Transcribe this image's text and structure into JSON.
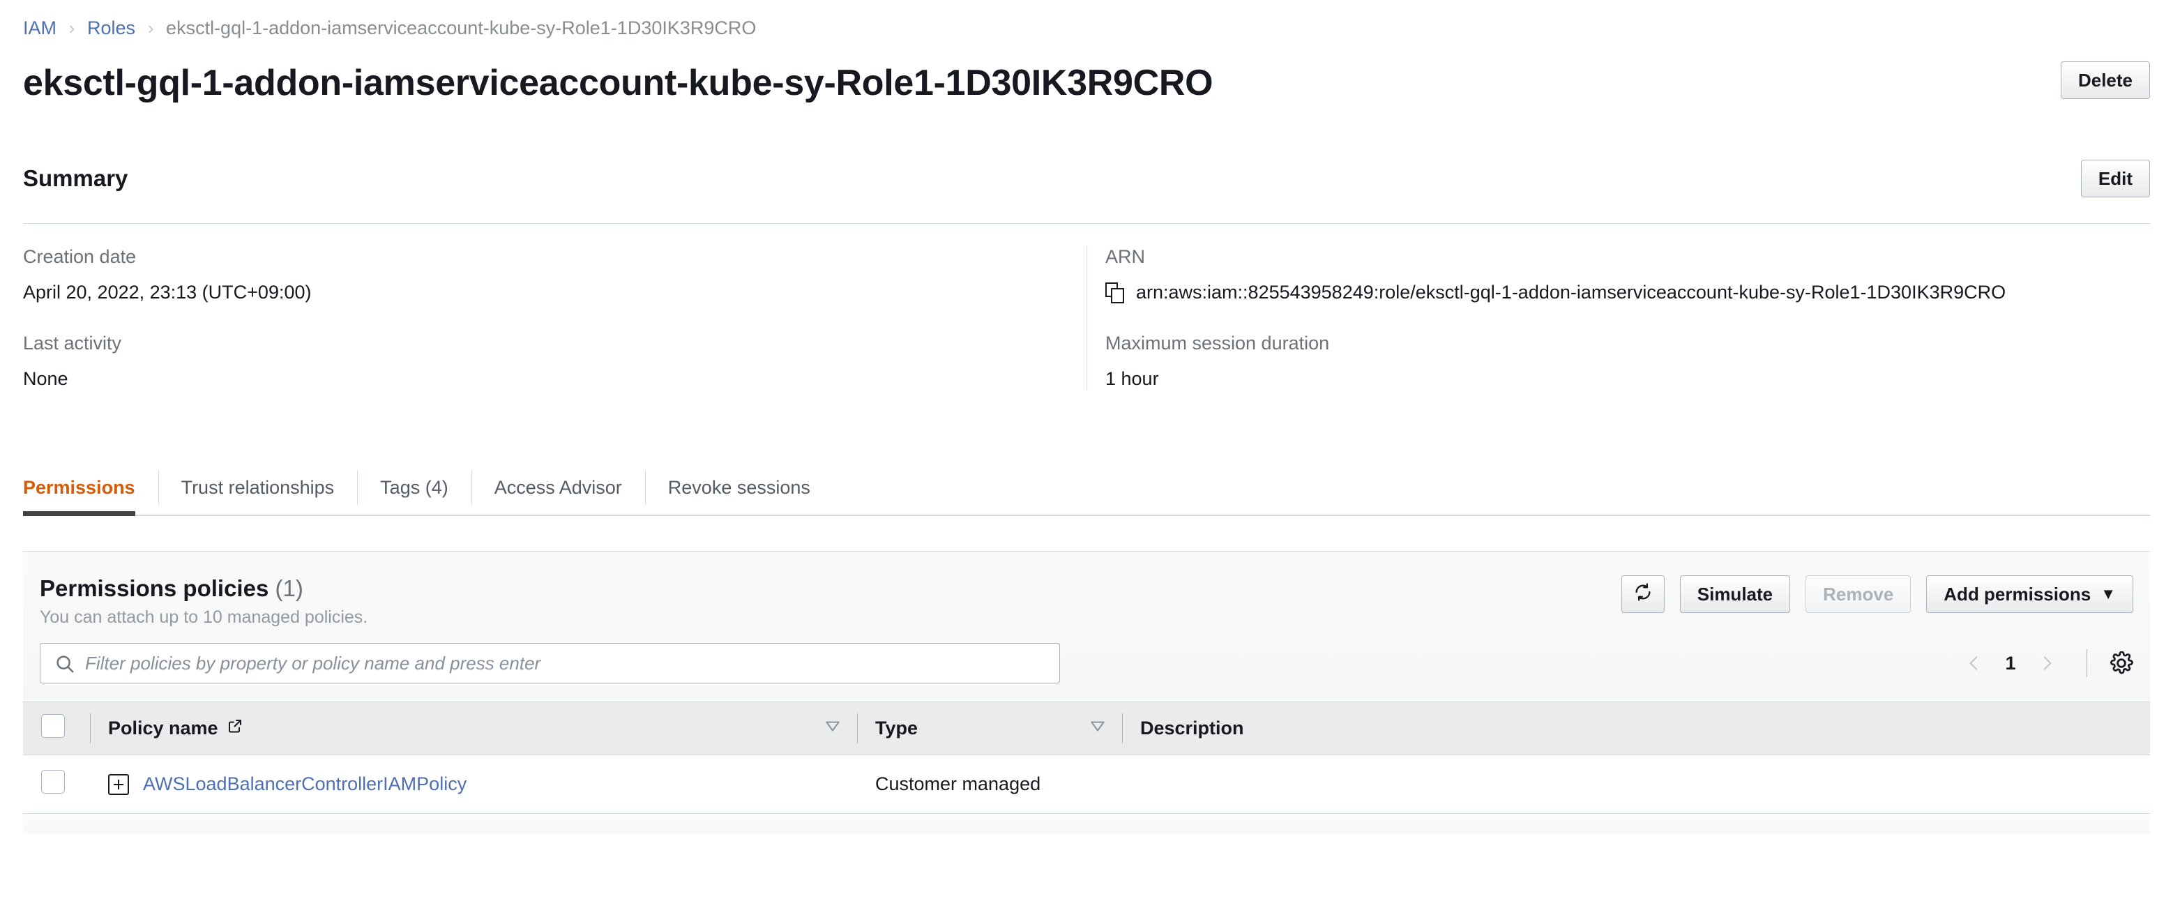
{
  "breadcrumb": {
    "items": [
      {
        "label": "IAM",
        "type": "link"
      },
      {
        "label": "Roles",
        "type": "link"
      },
      {
        "label": "eksctl-gql-1-addon-iamserviceaccount-kube-sy-Role1-1D30IK3R9CRO",
        "type": "current"
      }
    ],
    "separator": "›"
  },
  "header": {
    "title": "eksctl-gql-1-addon-iamserviceaccount-kube-sy-Role1-1D30IK3R9CRO",
    "delete_label": "Delete"
  },
  "summary": {
    "title": "Summary",
    "edit_label": "Edit",
    "fields": {
      "creation_date_label": "Creation date",
      "creation_date_value": "April 20, 2022, 23:13 (UTC+09:00)",
      "last_activity_label": "Last activity",
      "last_activity_value": "None",
      "arn_label": "ARN",
      "arn_value": "arn:aws:iam::825543958249:role/eksctl-gql-1-addon-iamserviceaccount-kube-sy-Role1-1D30IK3R9CRO",
      "max_session_label": "Maximum session duration",
      "max_session_value": "1 hour"
    }
  },
  "tabs": [
    {
      "label": "Permissions",
      "active": true
    },
    {
      "label": "Trust relationships",
      "active": false
    },
    {
      "label": "Tags (4)",
      "active": false
    },
    {
      "label": "Access Advisor",
      "active": false
    },
    {
      "label": "Revoke sessions",
      "active": false
    }
  ],
  "permissions_panel": {
    "heading": "Permissions policies",
    "count": "(1)",
    "subtitle": "You can attach up to 10 managed policies.",
    "buttons": {
      "refresh": "refresh-icon",
      "simulate": "Simulate",
      "remove": "Remove",
      "add_permissions": "Add permissions",
      "add_permissions_caret": "▼"
    },
    "search": {
      "placeholder": "Filter policies by property or policy name and press enter",
      "value": ""
    },
    "pagination": {
      "prev": "‹",
      "page": "1",
      "next": "›"
    },
    "table": {
      "columns": [
        {
          "label": "Policy name",
          "external_link": true,
          "sortable": true
        },
        {
          "label": "Type",
          "external_link": false,
          "sortable": true
        },
        {
          "label": "Description",
          "external_link": false,
          "sortable": false
        }
      ],
      "rows": [
        {
          "policy_name": "AWSLoadBalancerControllerIAMPolicy",
          "type": "Customer managed",
          "description": ""
        }
      ]
    }
  },
  "colors": {
    "link_blue": "#4d6fb3",
    "active_tab_orange": "#d45b07",
    "text_dark": "#16191f",
    "text_muted": "#6b7179",
    "border": "#d5dbdb"
  }
}
